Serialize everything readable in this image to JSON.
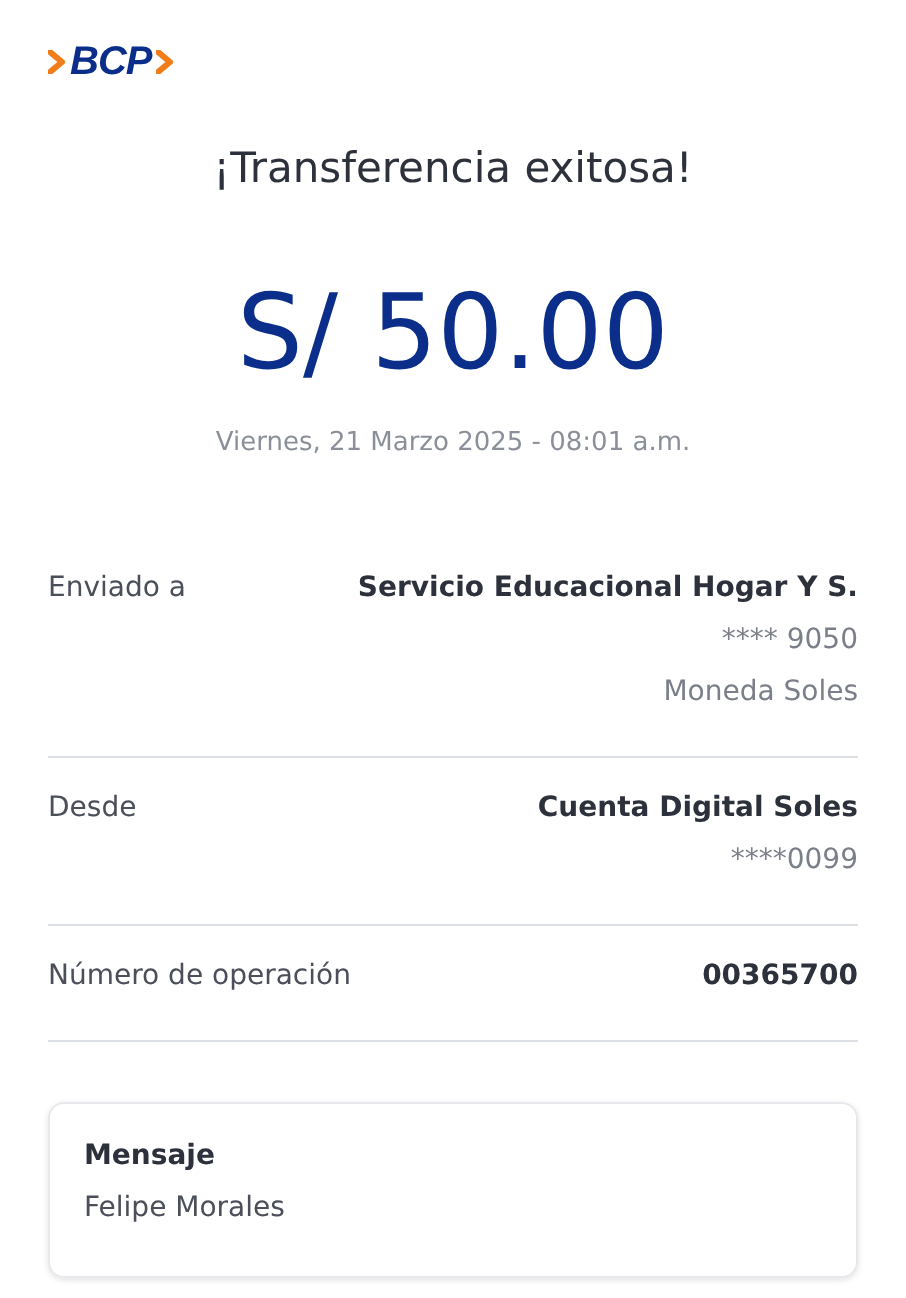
{
  "logo": {
    "text": "BCP"
  },
  "title": "¡Transferencia exitosa!",
  "amount": "S/ 50.00",
  "datetime": "Viernes, 21 Marzo 2025 - 08:01 a.m.",
  "details": [
    {
      "label": "Enviado a",
      "value": "Servicio Educacional Hogar Y S.",
      "extra": [
        "**** 9050",
        "Moneda Soles"
      ]
    },
    {
      "label": "Desde",
      "value": "Cuenta Digital Soles",
      "extra": [
        "****0099"
      ]
    },
    {
      "label": "Número de operación",
      "value": "00365700"
    }
  ],
  "message": {
    "heading": "Mensaje",
    "text": "Felipe Morales"
  }
}
